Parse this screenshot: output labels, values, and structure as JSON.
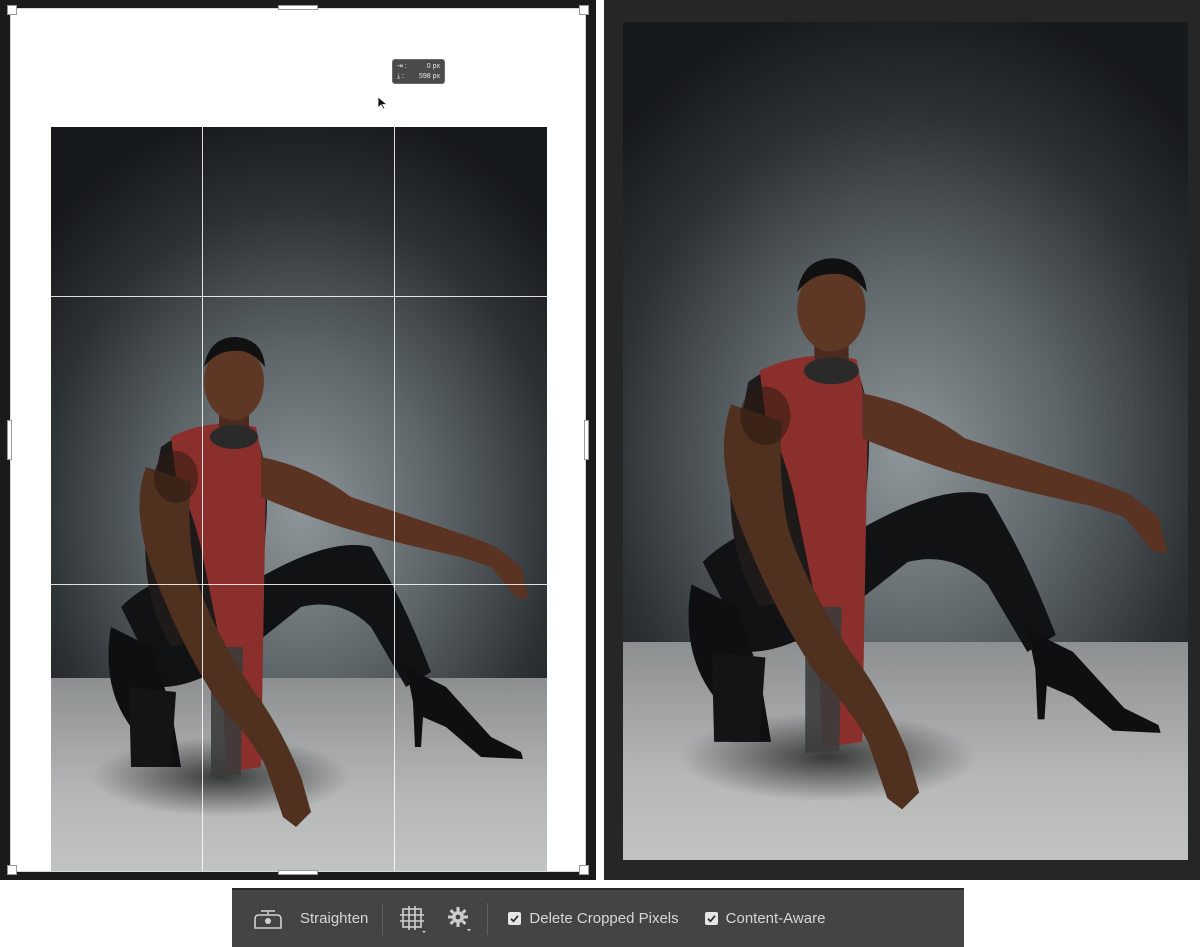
{
  "crop_tooltip": {
    "width_label": "⇥ :",
    "width_value": "0 px",
    "height_label": "⤓ :",
    "height_value": "598 px"
  },
  "toolbar": {
    "straighten_label": "Straighten",
    "delete_cropped_label": "Delete Cropped Pixels",
    "delete_cropped_checked": true,
    "content_aware_label": "Content-Aware",
    "content_aware_checked": true
  },
  "icons": {
    "straighten": "level-icon",
    "overlay": "grid-overlay-icon",
    "settings": "gear-icon",
    "cursor": "arrow-cursor-icon"
  },
  "colors": {
    "toolbar_bg": "#444444",
    "panel_left_bg": "#1b1b1b",
    "panel_right_bg": "#262626",
    "scarf": "#8a2f2c",
    "skin": "#5a3322"
  }
}
